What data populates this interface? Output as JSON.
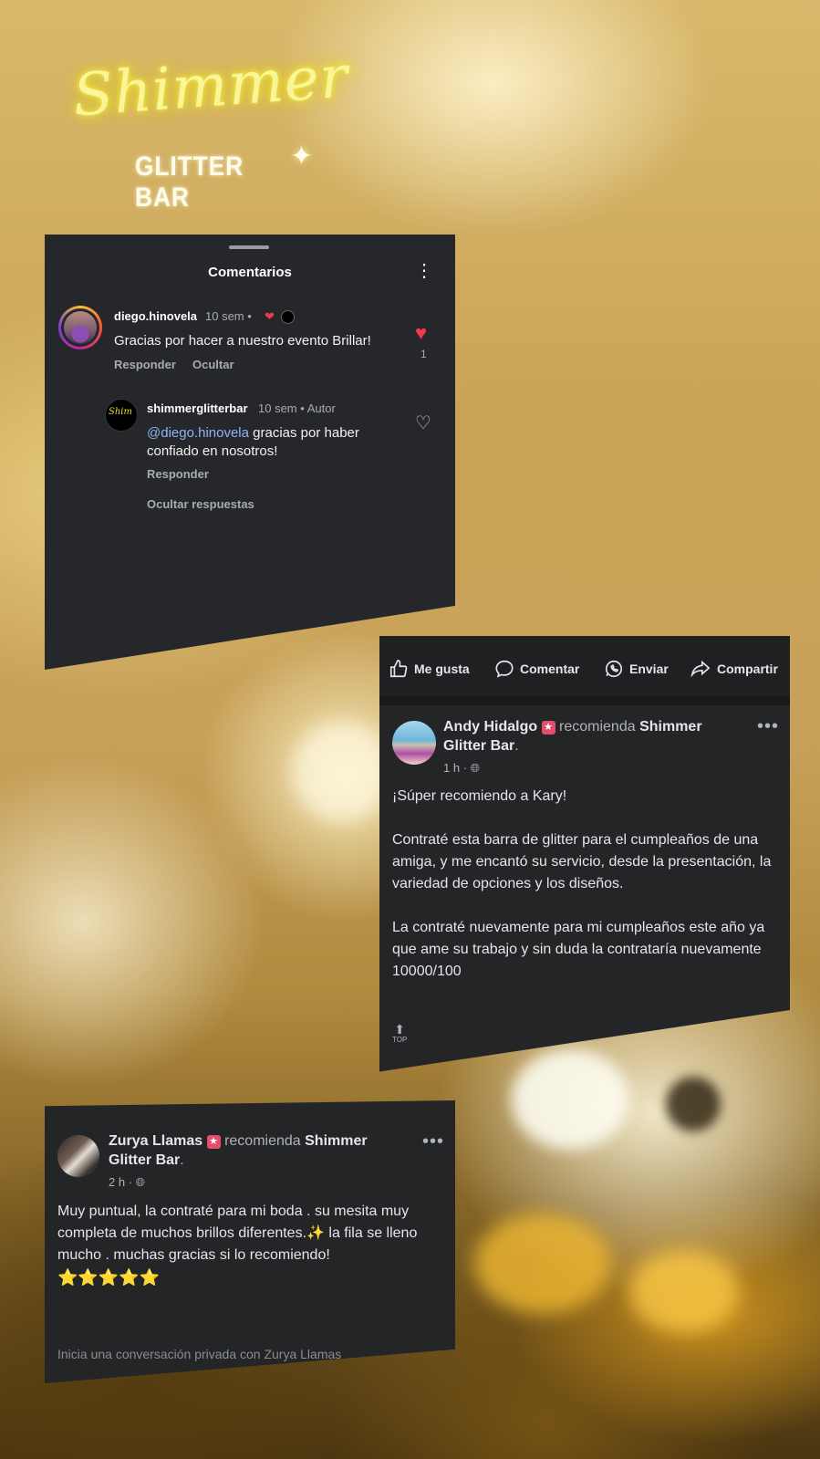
{
  "logo": {
    "script": "Shimmer",
    "subtitle": "GLITTER BAR"
  },
  "instagram": {
    "title": "Comentarios",
    "comment": {
      "username": "diego.hinovela",
      "time": "10 sem",
      "text": "Gracias por hacer a nuestro evento Brillar!",
      "reply_label": "Responder",
      "hide_label": "Ocultar",
      "like_count": "1"
    },
    "reply": {
      "username": "shimmerglitterbar",
      "time": "10 sem",
      "author_label": "Autor",
      "mention": "@diego.hinovela",
      "text": " gracias por haber confiado en nosotros!",
      "reply_label": "Responder"
    },
    "hide_replies_label": "Ocultar respuestas"
  },
  "facebook_post_1": {
    "actions": {
      "like": "Me gusta",
      "comment": "Comentar",
      "send": "Enviar",
      "share": "Compartir"
    },
    "author": "Andy Hidalgo",
    "recommends": "recomienda",
    "page_line1": "Shimmer",
    "page_line2": "Glitter Bar",
    "time": "1 h",
    "paragraphs": [
      "¡Súper recomiendo a Kary!",
      "Contraté esta barra de glitter para el cumpleaños de una amiga, y me encantó su servicio, desde la presentación, la variedad de opciones y los diseños.",
      "La contraté nuevamente para mi cumpleaños este año ya que ame su trabajo y sin duda la contrataría nuevamente 10000/100"
    ],
    "top_label": "TOP"
  },
  "facebook_post_2": {
    "author": "Zurya Llamas",
    "recommends": "recomienda",
    "page_line1": "Shimmer",
    "page_line2": "Glitter Bar",
    "time": "2 h",
    "text": "Muy puntual, la contraté para mi boda .  su mesita muy completa de muchos brillos diferentes.✨ la fila se lleno mucho . muchas gracias si lo recomiendo!",
    "stars": "⭐⭐⭐⭐⭐",
    "footer": "Inicia una conversación privada con Zurya Llamas"
  },
  "colors": {
    "panel_bg": "#242526",
    "like_red": "#f23a4d",
    "mention_blue": "#8fb4f5",
    "neon_yellow": "#fbf59a"
  }
}
